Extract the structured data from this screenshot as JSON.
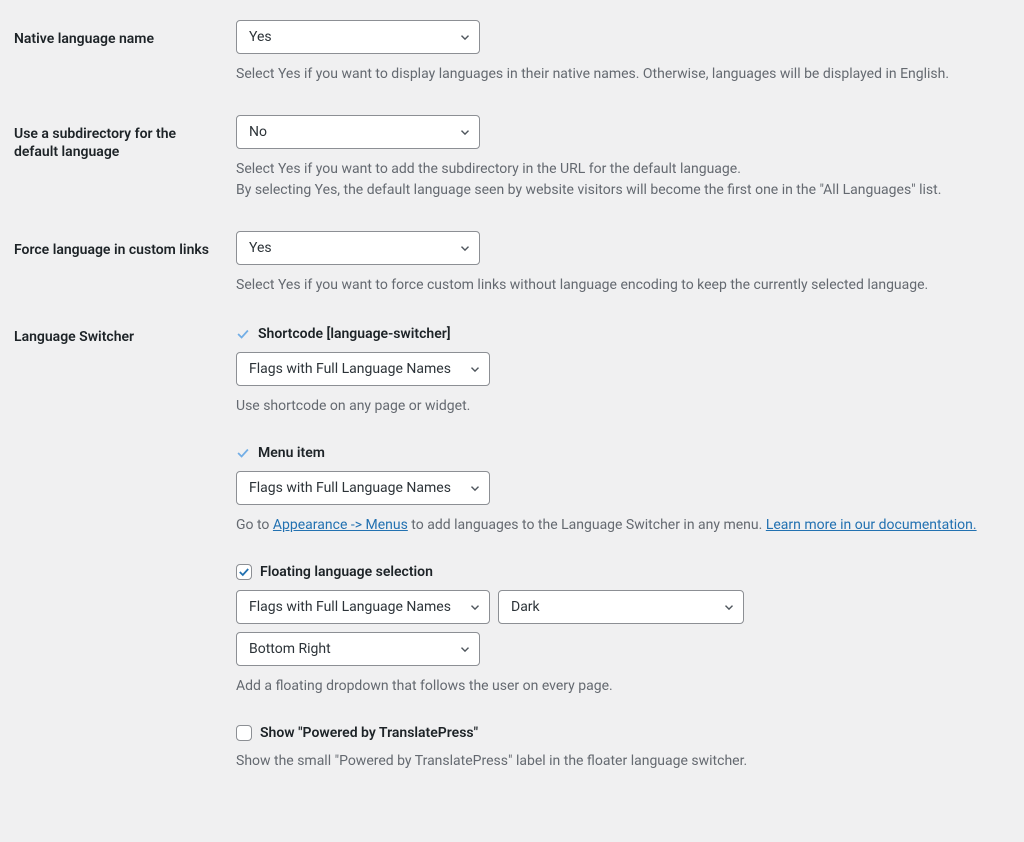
{
  "native_lang": {
    "label": "Native language name",
    "value": "Yes",
    "desc": "Select Yes if you want to display languages in their native names. Otherwise, languages will be displayed in English."
  },
  "subdir": {
    "label": "Use a subdirectory for the default language",
    "value": "No",
    "desc_line1": "Select Yes if you want to add the subdirectory in the URL for the default language.",
    "desc_line2": "By selecting Yes, the default language seen by website visitors will become the first one in the \"All Languages\" list."
  },
  "force_links": {
    "label": "Force language in custom links",
    "value": "Yes",
    "desc": "Select Yes if you want to force custom links without language encoding to keep the currently selected language."
  },
  "switcher": {
    "label": "Language Switcher",
    "shortcode": {
      "title": "Shortcode [language-switcher]",
      "value": "Flags with Full Language Names",
      "desc": "Use shortcode on any page or widget."
    },
    "menu_item": {
      "title": "Menu item",
      "value": "Flags with Full Language Names",
      "desc_pre": "Go to ",
      "link1": "Appearance -> Menus",
      "desc_mid": " to add languages to the Language Switcher in any menu. ",
      "link2": "Learn more in our documentation."
    },
    "floating": {
      "title": "Floating language selection",
      "display": "Flags with Full Language Names",
      "theme": "Dark",
      "position": "Bottom Right",
      "desc": "Add a floating dropdown that follows the user on every page."
    },
    "powered": {
      "title": "Show \"Powered by TranslatePress\"",
      "desc": "Show the small \"Powered by TranslatePress\" label in the floater language switcher."
    }
  }
}
